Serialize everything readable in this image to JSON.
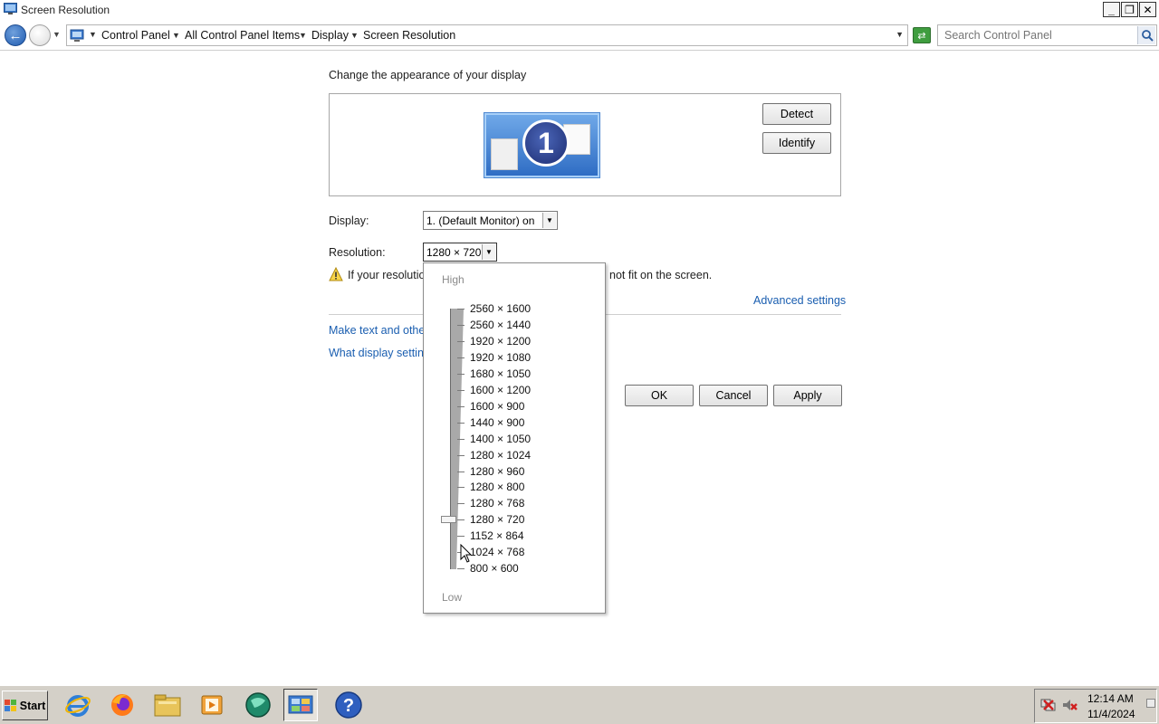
{
  "window": {
    "title": "Screen Resolution",
    "minimize": "_",
    "maximize": "❐",
    "close": "✕"
  },
  "address_bar": {
    "crumbs": [
      "Control Panel",
      "All Control Panel Items",
      "Display",
      "Screen Resolution"
    ],
    "search_placeholder": "Search Control Panel"
  },
  "main": {
    "heading": "Change the appearance of your display",
    "monitor_number": "1",
    "detect_label": "Detect",
    "identify_label": "Identify",
    "display_label": "Display:",
    "display_value": "1. (Default Monitor) on",
    "resolution_label": "Resolution:",
    "resolution_value": "1280 × 720",
    "warning_text_start": "If your resolutio",
    "warning_text_end": "not fit on the screen.",
    "advanced_settings": "Advanced settings",
    "link_text_size": "Make text and other",
    "link_display_settings": "What display setting",
    "ok_label": "OK",
    "cancel_label": "Cancel",
    "apply_label": "Apply"
  },
  "resolution_dropdown": {
    "high_label": "High",
    "low_label": "Low",
    "selected": "1280 × 720",
    "options": [
      "2560 × 1600",
      "2560 × 1440",
      "1920 × 1200",
      "1920 × 1080",
      "1680 × 1050",
      "1600 × 1200",
      "1600 × 900",
      "1440 × 900",
      "1400 × 1050",
      "1280 × 1024",
      "1280 × 960",
      "1280 × 800",
      "1280 × 768",
      "1280 × 720",
      "1152 × 864",
      "1024 × 768",
      "800 × 600"
    ]
  },
  "taskbar": {
    "start_label": "Start",
    "time": "12:14 AM",
    "date": "11/4/2024",
    "icons": [
      "internet-explorer-icon",
      "firefox-icon",
      "file-explorer-icon",
      "media-player-icon",
      "network-globe-icon",
      "control-panel-icon",
      "help-icon"
    ]
  },
  "colors": {
    "link": "#1a5eb0",
    "monitor_tile": "#2f6dc4",
    "taskbar": "#d4d0c8"
  }
}
